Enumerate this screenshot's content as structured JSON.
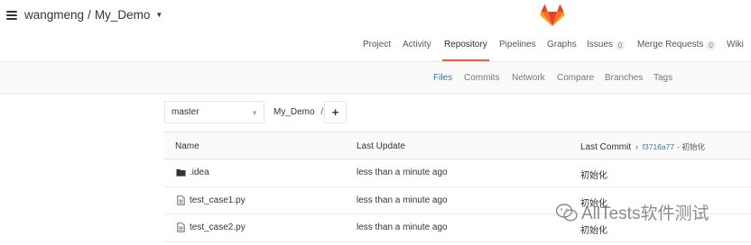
{
  "header": {
    "namespace": "wangmeng",
    "separator": "/",
    "project": "My_Demo"
  },
  "main_nav": [
    {
      "label": "Project"
    },
    {
      "label": "Activity"
    },
    {
      "label": "Repository",
      "active": true
    },
    {
      "label": "Pipelines"
    },
    {
      "label": "Graphs"
    },
    {
      "label": "Issues",
      "badge": "0"
    },
    {
      "label": "Merge Requests",
      "badge": "0"
    },
    {
      "label": "Wiki"
    }
  ],
  "sub_nav": [
    {
      "label": "Files",
      "active": true
    },
    {
      "label": "Commits"
    },
    {
      "label": "Network"
    },
    {
      "label": "Compare"
    },
    {
      "label": "Branches"
    },
    {
      "label": "Tags"
    }
  ],
  "tree": {
    "branch": "master",
    "path": "My_Demo",
    "path_sep": "/",
    "add_label": "+"
  },
  "table": {
    "headers": {
      "name": "Name",
      "last_update": "Last Update",
      "last_commit": "Last Commit"
    },
    "last_commit_sha": "f3716a77",
    "last_commit_sep": "-",
    "last_commit_message": "初始化",
    "rows": [
      {
        "type": "folder",
        "name": ".idea",
        "updated": "less than a minute ago",
        "message": "初始化"
      },
      {
        "type": "file",
        "name": "test_case1.py",
        "updated": "less than a minute ago",
        "message": "初始化"
      },
      {
        "type": "file",
        "name": "test_case2.py",
        "updated": "less than a minute ago",
        "message": "初始化"
      }
    ]
  },
  "watermark": {
    "text": "AllTests软件测试"
  },
  "colors": {
    "accent": "#e75e40",
    "link": "#3777b0",
    "logo_orange": "#fc6d26",
    "logo_dark": "#e24329",
    "logo_light": "#fca326"
  },
  "icons": [
    "hamburger-menu-icon",
    "gitlab-logo-icon",
    "chevron-down-icon",
    "plus-icon",
    "folder-icon",
    "file-icon",
    "chevron-right-icon",
    "wechat-icon"
  ]
}
